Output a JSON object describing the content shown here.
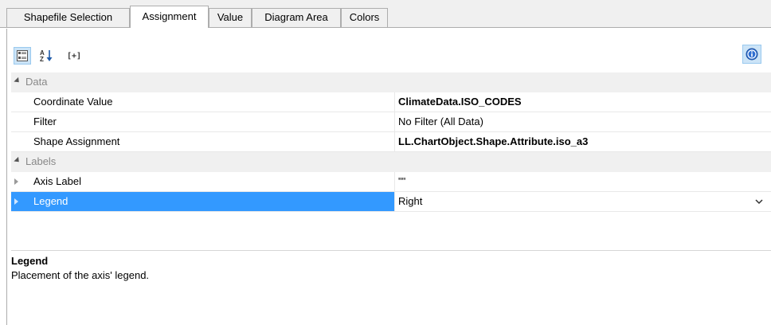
{
  "tabs": [
    {
      "label": "Shapefile Selection",
      "active": false
    },
    {
      "label": "Assignment",
      "active": true
    },
    {
      "label": "Value",
      "active": false
    },
    {
      "label": "Diagram Area",
      "active": false
    },
    {
      "label": "Colors",
      "active": false
    }
  ],
  "toolbar": {
    "categorized_icon": "categorized-view-icon",
    "sort_icon": "alphabetical-sort-icon",
    "expand_label": "[+]",
    "info_icon": "info-icon"
  },
  "grid": {
    "categories": [
      {
        "label": "Data",
        "properties": [
          {
            "name": "Coordinate Value",
            "value": "ClimateData.ISO_CODES",
            "bold": true
          },
          {
            "name": "Filter",
            "value": "No Filter (All Data)",
            "bold": false
          },
          {
            "name": "Shape Assignment",
            "value": "LL.ChartObject.Shape.Attribute.iso_a3",
            "bold": true
          }
        ]
      },
      {
        "label": "Labels",
        "properties": [
          {
            "name": "Axis Label",
            "value": "\"\"",
            "bold": false,
            "expandable": true
          },
          {
            "name": "Legend",
            "value": "Right",
            "bold": false,
            "expandable": true,
            "selected": true,
            "dropdown": true
          }
        ]
      }
    ]
  },
  "description": {
    "title": "Legend",
    "text": "Placement of the axis' legend."
  },
  "colors": {
    "selection": "#3399ff",
    "category_bg": "#f0f0f0",
    "category_text": "#888888",
    "button_active": "#cce4f7"
  }
}
